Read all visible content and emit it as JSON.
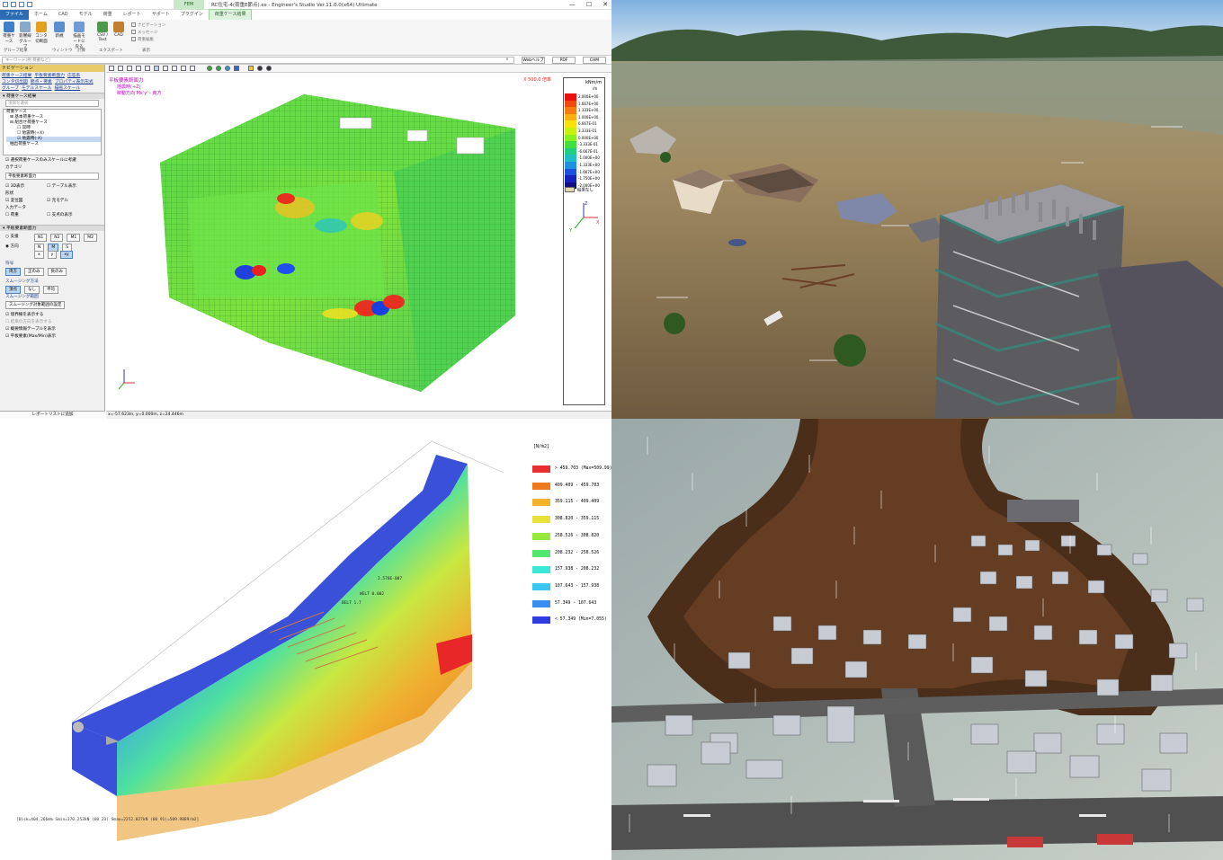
{
  "app": {
    "title_bar": "RC住宅-4(荷重E節点).es - Engineer's Studio Ver.11.0.0(x64) Ultimate",
    "context_tab_group": "FEM",
    "window_buttons": [
      "—",
      "☐",
      "✕"
    ],
    "tabs": [
      "ファイル",
      "ホーム",
      "CAD",
      "モデル",
      "荷重",
      "レポート",
      "サポート",
      "プラグイン",
      "荷重ケース結果"
    ],
    "ribbon": {
      "buttons": [
        {
          "label": "荷重ケース",
          "icon": "load-case-icon",
          "color": "#3d7fc9"
        },
        {
          "label": "影響線グループ",
          "icon": "influence-icon",
          "color": "#8aa8c8"
        },
        {
          "label": "コンタ切断面",
          "icon": "contour-icon",
          "color": "#e2a020"
        },
        {
          "label": "新規",
          "icon": "new-window-icon",
          "color": "#5b8fcf"
        },
        {
          "label": "描画モードに戻る",
          "icon": "draw-mode-icon",
          "color": "#6f9bd6"
        },
        {
          "label": "CSV / Text",
          "icon": "csv-icon",
          "color": "#4d9a4d"
        },
        {
          "label": "CAD",
          "icon": "cad-export-icon",
          "color": "#c08030"
        }
      ],
      "checkboxes": [
        "ナビゲーション",
        "メッセージ",
        "荷重編集"
      ],
      "groups": [
        "グループ結果",
        "ウィンドウ",
        "計算",
        "エクスポート",
        "表示"
      ]
    },
    "search": {
      "placeholder": "キーワード(例 荷重など)",
      "buttons": [
        "Webヘルプ",
        "PDF",
        "CHM"
      ]
    },
    "nav": {
      "header": "ナビゲーション",
      "links": [
        "荷重ケース結果",
        "平板要素断面力",
        "応答系",
        "コンタ切出図",
        "節点・要素",
        "プロパティ表示形式",
        "グループ",
        "モデルスケール",
        "描画スケール"
      ],
      "section1": "荷重ケース結果",
      "dropdown1": "項目を選択",
      "tree": [
        "荷重ケース",
        "基本荷重ケース",
        "組合せ荷重ケース",
        "常時",
        "地震時(+X)",
        "地震時(-X)",
        "抽出荷重ケース"
      ],
      "consider_scale": "選択荷重ケースのみスケールに考慮",
      "category_label": "カテゴリ",
      "category_value": "平板要素断面力",
      "display_3d": "3D表示",
      "table_display": "テーブル表示",
      "shape_label": "形状",
      "deformed": "変位図",
      "original_model": "元モデル",
      "input_data": "入力データ",
      "load": "荷重",
      "support": "支点の表示",
      "section2": "平板要素断面力",
      "node_label": "支援",
      "direction": "方向",
      "comp_buttons": [
        "N1",
        "N2",
        "M1",
        "M2",
        "N",
        "M",
        "S",
        "x",
        "y",
        "xy"
      ],
      "range_label": "符号",
      "range_buttons": [
        "両方",
        "正のみ",
        "負のみ"
      ],
      "smoothing_label": "スムージング方法",
      "smoothing_buttons": [
        "頂点",
        "なし",
        "平均"
      ],
      "smoothing_range_label": "スムージング範囲",
      "smoothing_range_btn": "スムージング対象範囲の設定",
      "opts": [
        "境界線を表示する",
        "結果の方向を表示する",
        "概要情報テーブルを表示",
        "平板要素(Max/Min)表示"
      ],
      "footer": "レポートリストに追加"
    },
    "viewport": {
      "title": "平板要素断面力",
      "sub1": "地震時(+Z)",
      "sub2": "柳動方向 Mx'y' - 両方",
      "scale": "X 500.0 倍率",
      "legend_unit": "kNm/m",
      "legend_unit2": "/m",
      "legend_values": [
        "2.000E+00",
        "1.667E+00",
        "1.333E+00",
        "1.000E+00",
        "6.667E-01",
        "3.333E-01",
        "0.000E+00",
        "-3.333E-01",
        "-6.667E-01",
        "-1.000E+00",
        "-1.333E+00",
        "-1.667E+00",
        "-1.750E+00",
        "-2.000E+00"
      ],
      "legend_colors": [
        "#e81010",
        "#f04a10",
        "#f57c10",
        "#f9b010",
        "#fbe010",
        "#c8f010",
        "#8cf020",
        "#40e040",
        "#20d080",
        "#20c0c0",
        "#2090e0",
        "#2050e0",
        "#1820c0",
        "#101080"
      ],
      "no_result": "結果なし",
      "axes": [
        "X",
        "Y",
        "Z"
      ]
    },
    "status": "x=-57.623m, y=0.000m, z=24.446m"
  },
  "scene_flood": {
    "icon": "flood-simulation-icon"
  },
  "slope": {
    "unit": "[N/m2]",
    "legend_rows": [
      "> 459.703  (Max=509.99)",
      "409.409 - 459.703",
      "359.115 - 409.409",
      "308.820 - 359.115",
      "258.526 - 308.820",
      "208.232 - 258.526",
      "157.938 - 208.232",
      "107.643 - 157.938",
      "57.349 - 107.643",
      "< 57.349  (Min=7.055)"
    ],
    "legend_colors": [
      "#e83030",
      "#ef7a1e",
      "#f3b22a",
      "#e8e23a",
      "#98e83c",
      "#50e870",
      "#3ae8d8",
      "#3ac8f0",
      "#3a8ef0",
      "#2f3ce0"
    ],
    "footer": "[Disk=404.266mm  Smin=370.253kN (60 23)  Smax=2252.027kN (60 91)=509.9889/m2]",
    "labels": [
      "2.578E-007",
      "WELT 0.002",
      "BELT 1.7"
    ]
  },
  "scene_landslide": {
    "icon": "landslide-simulation-icon"
  }
}
